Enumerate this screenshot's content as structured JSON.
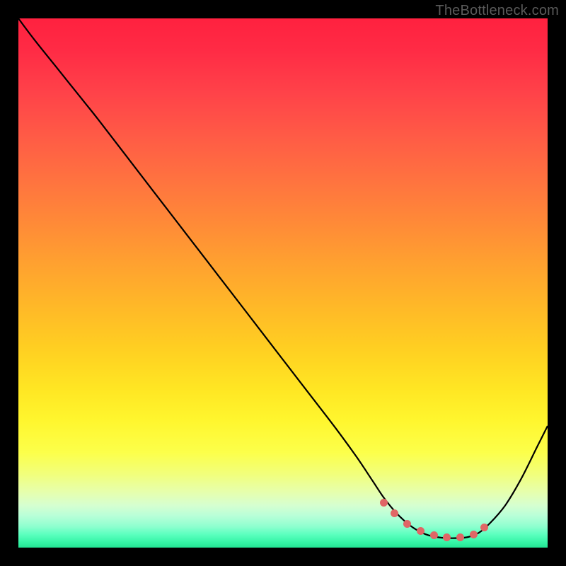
{
  "watermark": "TheBottleneck.com",
  "colors": {
    "curve_stroke": "#000000",
    "marker_fill": "#e06666",
    "frame_bg": "#000000"
  },
  "chart_data": {
    "type": "line",
    "title": "",
    "xlabel": "",
    "ylabel": "",
    "xlim": [
      0,
      100
    ],
    "ylim": [
      0,
      100
    ],
    "series": [
      {
        "name": "bottleneck-curve",
        "x": [
          0,
          3,
          7,
          11,
          15,
          20,
          25,
          30,
          35,
          40,
          45,
          50,
          55,
          60,
          64,
          67,
          69,
          71,
          73,
          75,
          77,
          79,
          81,
          83,
          85,
          87,
          89,
          92,
          95,
          98,
          100
        ],
        "y": [
          100,
          96,
          91,
          86,
          81,
          74.5,
          68,
          61.5,
          55,
          48.5,
          42,
          35.5,
          29,
          22.5,
          17,
          12.5,
          9.5,
          7,
          5,
          3.5,
          2.5,
          2,
          1.8,
          1.8,
          2,
          2.8,
          4.5,
          8,
          13,
          19,
          23
        ]
      }
    ],
    "markers": {
      "name": "trough-dots",
      "x": [
        69,
        71,
        73.5,
        76,
        78.5,
        81,
        83.5,
        86,
        88
      ],
      "y": [
        8.5,
        6.5,
        4.5,
        3.2,
        2.4,
        2.0,
        2.0,
        2.5,
        3.8
      ]
    }
  }
}
